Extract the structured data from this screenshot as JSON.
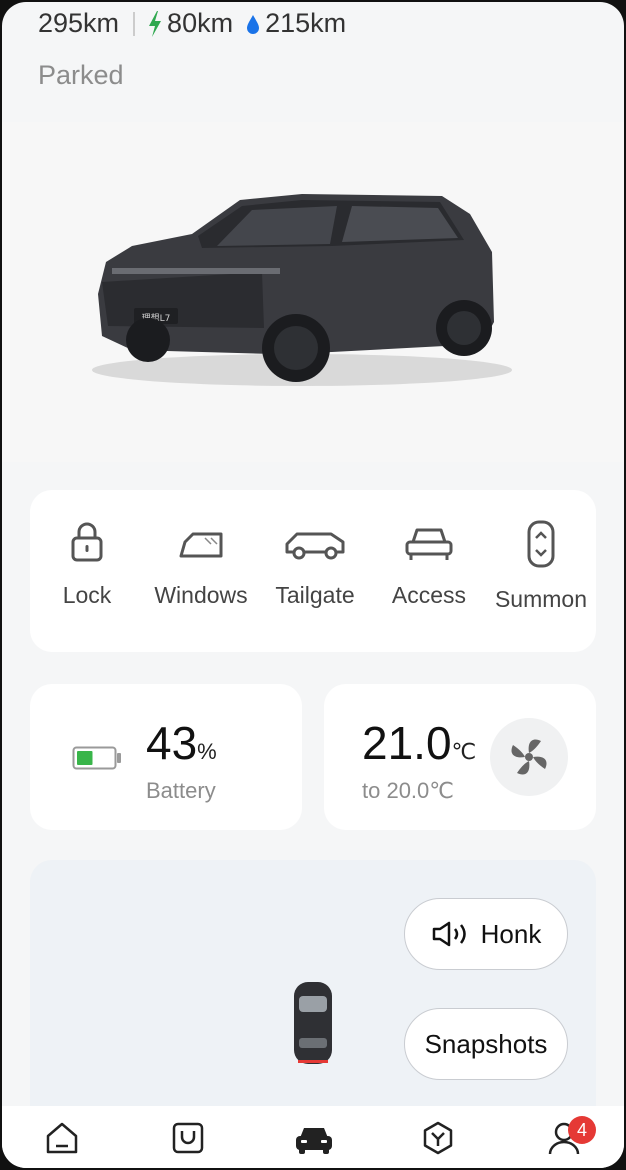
{
  "header": {
    "total_range": "295km",
    "electric_range": "80km",
    "fuel_range": "215km",
    "status": "Parked"
  },
  "vehicle": {
    "model_plate": "理想L7"
  },
  "controls": [
    {
      "label": "Lock",
      "icon": "lock-icon"
    },
    {
      "label": "Windows",
      "icon": "window-icon"
    },
    {
      "label": "Tailgate",
      "icon": "tailgate-icon"
    },
    {
      "label": "Access",
      "icon": "car-access-icon"
    },
    {
      "label": "Summon",
      "icon": "summon-icon"
    }
  ],
  "battery": {
    "value": "43",
    "unit": "%",
    "label": "Battery",
    "level": 0.43
  },
  "climate": {
    "current": "21.0",
    "unit": "℃",
    "target": "to 20.0℃",
    "icon": "fan-icon"
  },
  "actions": {
    "honk": "Honk",
    "snapshots": "Snapshots"
  },
  "tabbar": {
    "items": [
      "home-icon",
      "shop-icon",
      "car-icon",
      "discover-icon",
      "profile-icon"
    ],
    "active": "car-icon",
    "profile_badge": "4"
  },
  "colors": {
    "electric": "#2fa84f",
    "fuel": "#1a73e8",
    "battery_fill": "#39b54a",
    "badge": "#e53935"
  }
}
